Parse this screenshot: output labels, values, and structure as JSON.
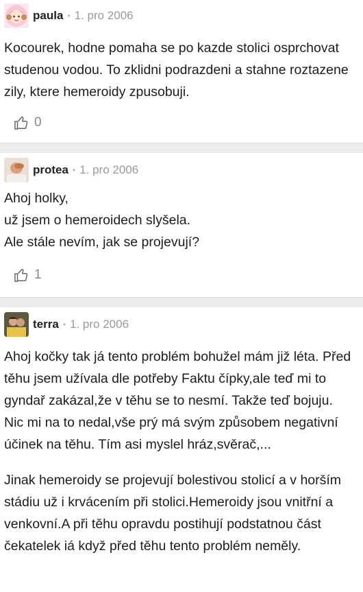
{
  "posts": [
    {
      "author": "paula",
      "separator": "•",
      "date": "1. pro 2006",
      "avatar_icon": "girl-avatar",
      "paragraphs": [
        "Kocourek, hodne pomaha se po kazde stolici osprchovat studenou vodou. To zklidni podrazdeni a stahne roztazene zily, ktere hemeroidy zpusobuji."
      ],
      "likes": "0"
    },
    {
      "author": "protea",
      "separator": "•",
      "date": "1. pro 2006",
      "avatar_icon": "photo-avatar",
      "paragraphs": [
        "Ahoj holky,\nuž jsem o hemeroidech slyšela.\nAle stále nevím, jak se projevují?"
      ],
      "likes": "1"
    },
    {
      "author": "terra",
      "separator": "•",
      "date": "1. pro 2006",
      "avatar_icon": "photo-avatar",
      "paragraphs": [
        "Ahoj kočky tak já tento problém bohužel mám již léta. Před těhu jsem užívala dle potřeby Faktu čípky,ale teď mi to gyndař zakázal,že v těhu se to nesmí. Takže teď bojuju. Nic mi na to nedal,vše prý má svým způsobem negativní účinek na těhu. Tím asi myslel hráz,svěrač,...",
        "Jinak hemeroidy se projevují bolestivou stolicí a v horším stádiu už i krvácením při stolici.Hemeroidy jsou vnitřní a venkovní.A při těhu opravdu postihují podstatnou část čekatelek iá když před těhu tento problém neměly."
      ],
      "likes": ""
    }
  ]
}
